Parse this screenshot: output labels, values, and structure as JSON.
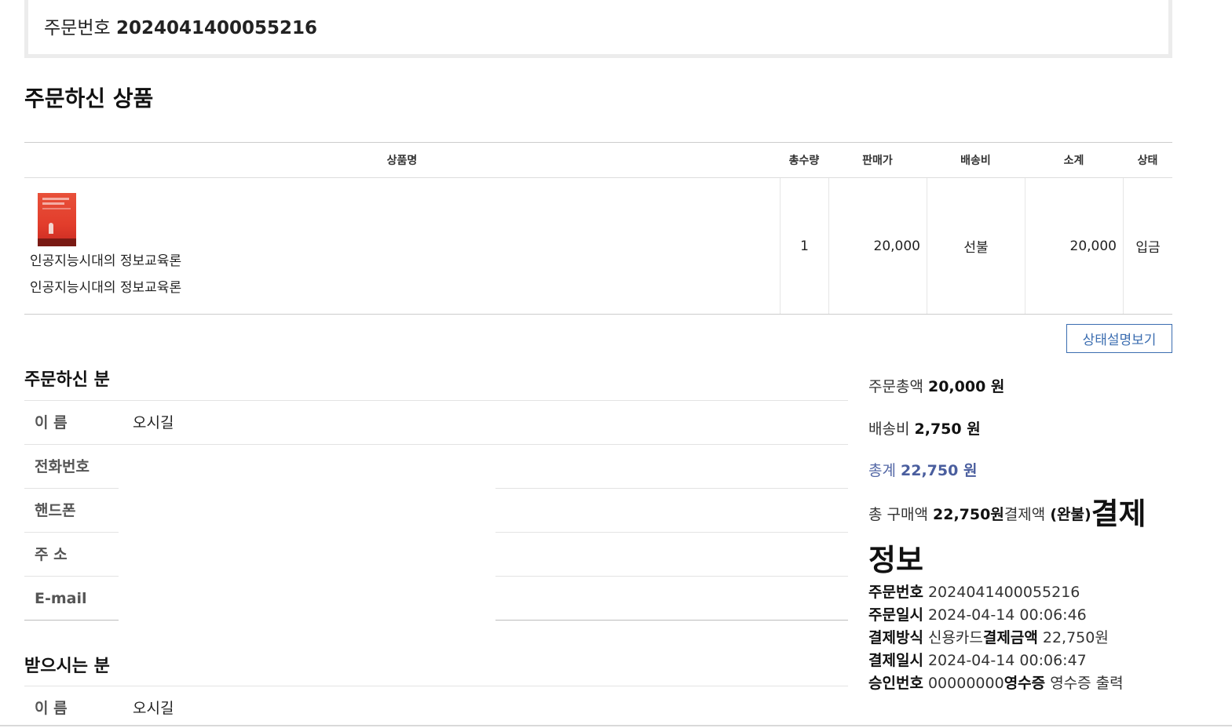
{
  "order_header": {
    "label": "주문번호",
    "number": "2024041400055216"
  },
  "products": {
    "title": "주문하신 상품",
    "headers": {
      "name": "상품명",
      "qty": "총수량",
      "price": "판매가",
      "shipping": "배송비",
      "subtotal": "소계",
      "status": "상태"
    },
    "rows": [
      {
        "name_line1": "인공지능시대의 정보교육론",
        "name_line2": "인공지능시대의 정보교육론",
        "qty": "1",
        "price": "20,000",
        "shipping": "선불",
        "subtotal": "20,000",
        "status": "입금"
      }
    ],
    "status_button": "상태설명보기"
  },
  "orderer": {
    "title": "주문하신 분",
    "rows": [
      {
        "label": "이 름",
        "value": "오시길"
      },
      {
        "label": "전화번호",
        "value": ""
      },
      {
        "label": "핸드폰",
        "value": ""
      },
      {
        "label": "주 소",
        "value": ""
      },
      {
        "label": "E-mail",
        "value": ""
      }
    ]
  },
  "receiver": {
    "title": "받으시는 분",
    "rows": [
      {
        "label": "이 름",
        "value": "오시길"
      }
    ]
  },
  "summary": {
    "order_total_label": "주문총액",
    "order_total_value": "20,000 원",
    "shipping_label": "배송비",
    "shipping_value": "2,750 원",
    "total_label": "총계",
    "total_value": "22,750 원",
    "purchase_label": "총 구매액",
    "purchase_value": "22,750원",
    "paid_label": "결제액",
    "paid_value": "(완불)"
  },
  "payment": {
    "title": "결제정보",
    "order_no_label": "주문번호",
    "order_no_value": "2024041400055216",
    "order_date_label": "주문일시",
    "order_date_value": "2024-04-14 00:06:46",
    "method_label": "결제방식",
    "method_value": "신용카드",
    "amount_label": "결제금액",
    "amount_value": "22,750원",
    "pay_date_label": "결제일시",
    "pay_date_value": "2024-04-14 00:06:47",
    "approval_label": "승인번호",
    "approval_value": "00000000",
    "receipt_label": "영수증",
    "receipt_value": "영수증 출력"
  }
}
